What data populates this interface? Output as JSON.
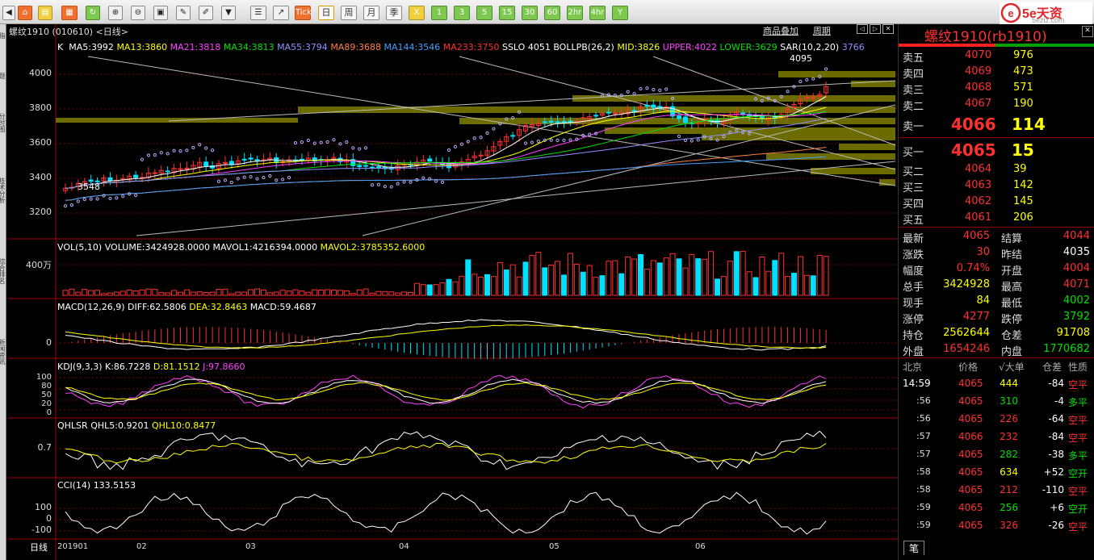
{
  "toolbar": {
    "tick": "Tick",
    "period_day": "日",
    "period_week": "周",
    "period_month": "月",
    "period_season": "季",
    "period_x": "X",
    "p1": "1",
    "p3": "3",
    "p5": "5",
    "p15": "15",
    "p30": "30",
    "p60": "60",
    "p2hr": "2hr",
    "p4hr": "4hr",
    "pY": "Y",
    "chart_mode_left": "商品叠加",
    "chart_mode_right": "周期"
  },
  "logo": {
    "text": "5e天资",
    "sub": "5eziz.com"
  },
  "sidebar": {
    "tabs": [
      "指",
      "题",
      "分时图",
      "技术分析",
      "综合排名",
      "新闻资讯"
    ]
  },
  "chart": {
    "title": "螺纹1910 (010610) <日线>",
    "ma_line": {
      "k": "K",
      "ma5": "MA5:3992",
      "ma13": "MA13:3860",
      "ma21": "MA21:3818",
      "ma34": "MA34:3813",
      "ma55": "MA55:3794",
      "ma89": "MA89:3688",
      "ma144": "MA144:3546",
      "ma233": "MA233:3750",
      "sslo": "SSLO 4051",
      "boll": "BOLLPB(26,2)",
      "mid": "MID:3826",
      "upper": "UPPER:4022",
      "lower": "LOWER:3629",
      "sar": "SAR(10,2,20)",
      "sar_v": "3766"
    },
    "high_marker": "4095",
    "low_marker": "3548",
    "price_axis": [
      "4000",
      "3800",
      "3600",
      "3400",
      "3200"
    ],
    "vol_line": {
      "t": "VOL(5,10)",
      "v": "VOLUME:3424928.0000",
      "m1": "MAVOL1:4216394.0000",
      "m2": "MAVOL2:3785352.6000"
    },
    "vol_axis": "400万",
    "macd_line": {
      "t": "MACD(12,26,9)",
      "diff": "DIFF:62.5806",
      "dea": "DEA:32.8463",
      "macd": "MACD:59.4687"
    },
    "macd_axis": "0",
    "kdj_line": {
      "t": "KDJ(9,3,3)",
      "k": "K:86.7228",
      "d": "D:81.1512",
      "j": "J:97.8660"
    },
    "kdj_axis": [
      "100",
      "80",
      "50",
      "20",
      "0"
    ],
    "qhlsr_line": {
      "t": "QHLSR",
      "q5": "QHL5:0.9201",
      "q10": "QHL10:0.8477"
    },
    "qhlsr_axis": "0.7",
    "cci_line": {
      "t": "CCI(14)",
      "v": "133.5153"
    },
    "cci_axis": [
      "100",
      "0",
      "-100"
    ],
    "x_axis": [
      "201901",
      "02",
      "03",
      "04",
      "05",
      "06"
    ],
    "corner_label": "日线"
  },
  "quote": {
    "name": "螺纹1910(rb1910)",
    "asks": [
      {
        "l": "卖五",
        "p": "4070",
        "v": "976"
      },
      {
        "l": "卖四",
        "p": "4069",
        "v": "473"
      },
      {
        "l": "卖三",
        "p": "4068",
        "v": "571"
      },
      {
        "l": "卖二",
        "p": "4067",
        "v": "190"
      },
      {
        "l": "卖一",
        "p": "4066",
        "v": "114"
      }
    ],
    "bids": [
      {
        "l": "买一",
        "p": "4065",
        "v": "15"
      },
      {
        "l": "买二",
        "p": "4064",
        "v": "39"
      },
      {
        "l": "买三",
        "p": "4063",
        "v": "142"
      },
      {
        "l": "买四",
        "p": "4062",
        "v": "145"
      },
      {
        "l": "买五",
        "p": "4061",
        "v": "206"
      }
    ],
    "stats": [
      {
        "l1": "最新",
        "v1": "4065",
        "l2": "结算",
        "v2": "4044"
      },
      {
        "l1": "涨跌",
        "v1": "30",
        "l2": "昨结",
        "v2": "4035"
      },
      {
        "l1": "幅度",
        "v1": "0.74%",
        "l2": "开盘",
        "v2": "4004"
      },
      {
        "l1": "总手",
        "v1": "3424928",
        "l2": "最高",
        "v2": "4071"
      },
      {
        "l1": "现手",
        "v1": "84",
        "l2": "最低",
        "v2": "4002"
      },
      {
        "l1": "涨停",
        "v1": "4277",
        "l2": "跌停",
        "v2": "3792"
      },
      {
        "l1": "持仓",
        "v1": "2562644",
        "l2": "仓差",
        "v2": "91708"
      },
      {
        "l1": "外盘",
        "v1": "1654246",
        "l2": "内盘",
        "v2": "1770682"
      }
    ],
    "ticks_head": {
      "c1": "北京",
      "c2": "价格",
      "c3": "√大单",
      "c4": "仓差",
      "c5": "性质"
    },
    "ticks": [
      {
        "t": "14:59",
        "p": "4065",
        "v": "444",
        "d": "-84",
        "n": "空平"
      },
      {
        "t": ":56",
        "p": "4065",
        "v": "310",
        "d": "-4",
        "n": "多平"
      },
      {
        "t": ":56",
        "p": "4065",
        "v": "226",
        "d": "-64",
        "n": "空平"
      },
      {
        "t": ":57",
        "p": "4066",
        "v": "232",
        "d": "-84",
        "n": "空平"
      },
      {
        "t": ":57",
        "p": "4065",
        "v": "282",
        "d": "-38",
        "n": "多平"
      },
      {
        "t": ":58",
        "p": "4065",
        "v": "634",
        "d": "+52",
        "n": "空开"
      },
      {
        "t": ":58",
        "p": "4065",
        "v": "212",
        "d": "-110",
        "n": "空平"
      },
      {
        "t": ":59",
        "p": "4065",
        "v": "256",
        "d": "+6",
        "n": "空开"
      },
      {
        "t": ":59",
        "p": "4065",
        "v": "326",
        "d": "-26",
        "n": "空平"
      }
    ],
    "bottom_tab": "笔"
  },
  "colors": {
    "up": "#ff3030",
    "down": "#00e0ff",
    "bg": "#000000",
    "grid": "#8b0000"
  }
}
